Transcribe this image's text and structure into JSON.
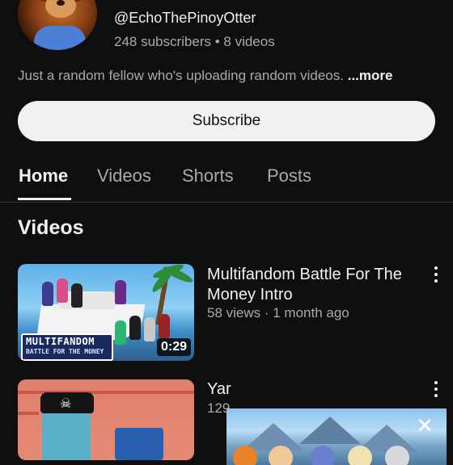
{
  "channel": {
    "handle": "@EchoThePinoyOtter",
    "stats": "248 subscribers • 8 videos",
    "description": "Just a random fellow who's uploading random videos.",
    "more_label": "...more",
    "subscribe_label": "Subscribe"
  },
  "tabs": [
    {
      "label": "Home",
      "active": true
    },
    {
      "label": "Videos",
      "active": false
    },
    {
      "label": "Shorts",
      "active": false
    },
    {
      "label": "Posts",
      "active": false
    }
  ],
  "section_title": "Videos",
  "videos": [
    {
      "title": "Multifandom Battle For The Money Intro",
      "meta": "58 views · 1 month ago",
      "duration": "0:29",
      "thumb_text_1": "MULTIFANDOM",
      "thumb_text_2": "BATTLE FOR THE MONEY"
    },
    {
      "title": "Yar",
      "meta": "129"
    }
  ],
  "mini_player": {
    "close_icon": "close-icon"
  },
  "colors": {
    "background": "#0f0f0f",
    "text": "#f1f1f1",
    "secondary": "#aaaaaa",
    "button": "#f1f1f1"
  }
}
